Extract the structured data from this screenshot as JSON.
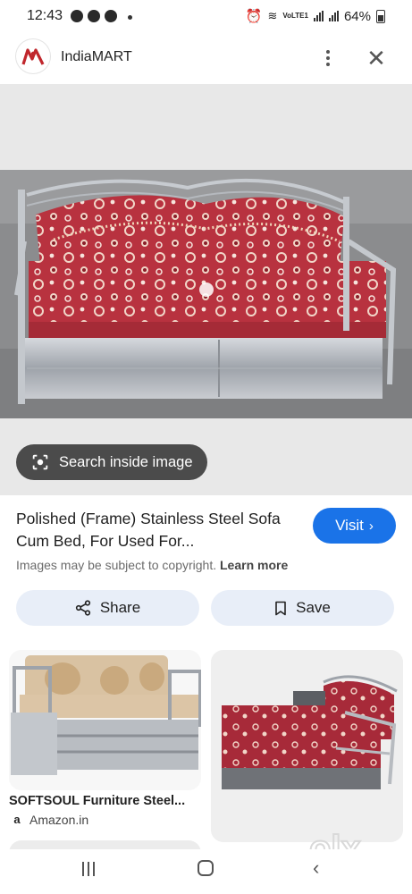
{
  "status_bar": {
    "time": "12:43",
    "lte_label": "VoLTE1",
    "battery": "64%"
  },
  "app": {
    "title": "IndiaMART",
    "logo_icon": "indiamart-logo",
    "brand_color": "#c0262c"
  },
  "image_viewer": {
    "search_inside_label": "Search inside image"
  },
  "result": {
    "title": "Polished (Frame) Stainless Steel Sofa Cum Bed, For Used For...",
    "visit_label": "Visit",
    "copyright_text": "Images may be subject to copyright.",
    "learn_more_label": "Learn more",
    "share_label": "Share",
    "save_label": "Save",
    "accent_color": "#1a73e8"
  },
  "related": [
    {
      "title": "SOFTSOUL Furniture Steel...",
      "source": "Amazon.in"
    }
  ],
  "watermark": {
    "text": "olx"
  }
}
